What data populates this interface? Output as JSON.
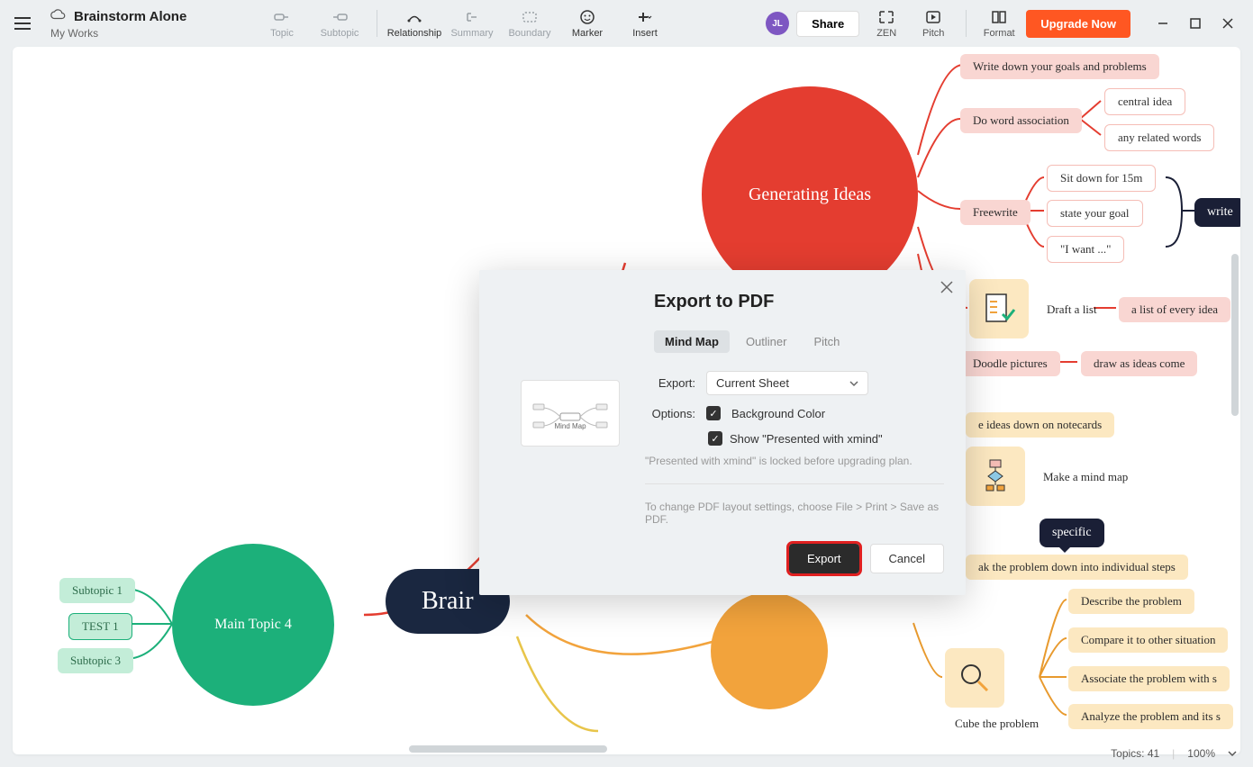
{
  "header": {
    "title": "Brainstorm Alone",
    "breadcrumb": "My Works",
    "share": "Share",
    "upgrade": "Upgrade Now"
  },
  "tools": {
    "topic": "Topic",
    "subtopic": "Subtopic",
    "relationship": "Relationship",
    "summary": "Summary",
    "boundary": "Boundary",
    "marker": "Marker",
    "insert": "Insert",
    "zen": "ZEN",
    "pitch": "Pitch",
    "format": "Format"
  },
  "avatar": "JL",
  "mindmap": {
    "central_big": "Brair",
    "red_circle": "Generating Ideas",
    "green_circle": "Main Topic 4",
    "green_subs": [
      "Subtopic 1",
      "TEST 1",
      "Subtopic 3"
    ],
    "red_branch": {
      "r1": "Write down your goals and problems",
      "r2": "Do word association",
      "r2a": "central idea",
      "r2b": "any related words",
      "r3": "Freewrite",
      "r3a": "Sit down for 15m",
      "r3b": "state your goal",
      "r3c": "\"I want ...\"",
      "r3_dark": "write",
      "r4": "Draft a list",
      "r4a": "a list of every idea",
      "r5": "Doodle pictures",
      "r5a": "draw as ideas come"
    },
    "yellow_branch": {
      "y1": "e ideas down on notecards",
      "y2": "Make a mind map",
      "y3_dark": "specific",
      "y4": "ak the problem down into individual steps",
      "y5": "Cube the problem",
      "y5a": "Describe the problem",
      "y5b": "Compare it to other situation",
      "y5c": "Associate the problem with s",
      "y5d": "Analyze the problem and its s"
    }
  },
  "dialog": {
    "title": "Export to PDF",
    "tabs": {
      "mindmap": "Mind Map",
      "outliner": "Outliner",
      "pitch": "Pitch"
    },
    "export_label": "Export:",
    "export_value": "Current Sheet",
    "options_label": "Options:",
    "opt_bg": "Background Color",
    "opt_presented": "Show \"Presented with xmind\"",
    "hint1": "\"Presented with xmind\" is locked before upgrading plan.",
    "hint2": "To change PDF layout settings, choose File > Print > Save as PDF.",
    "export_btn": "Export",
    "cancel_btn": "Cancel",
    "preview_label": "Mind Map"
  },
  "status": {
    "topics": "Topics: 41",
    "zoom": "100%"
  }
}
